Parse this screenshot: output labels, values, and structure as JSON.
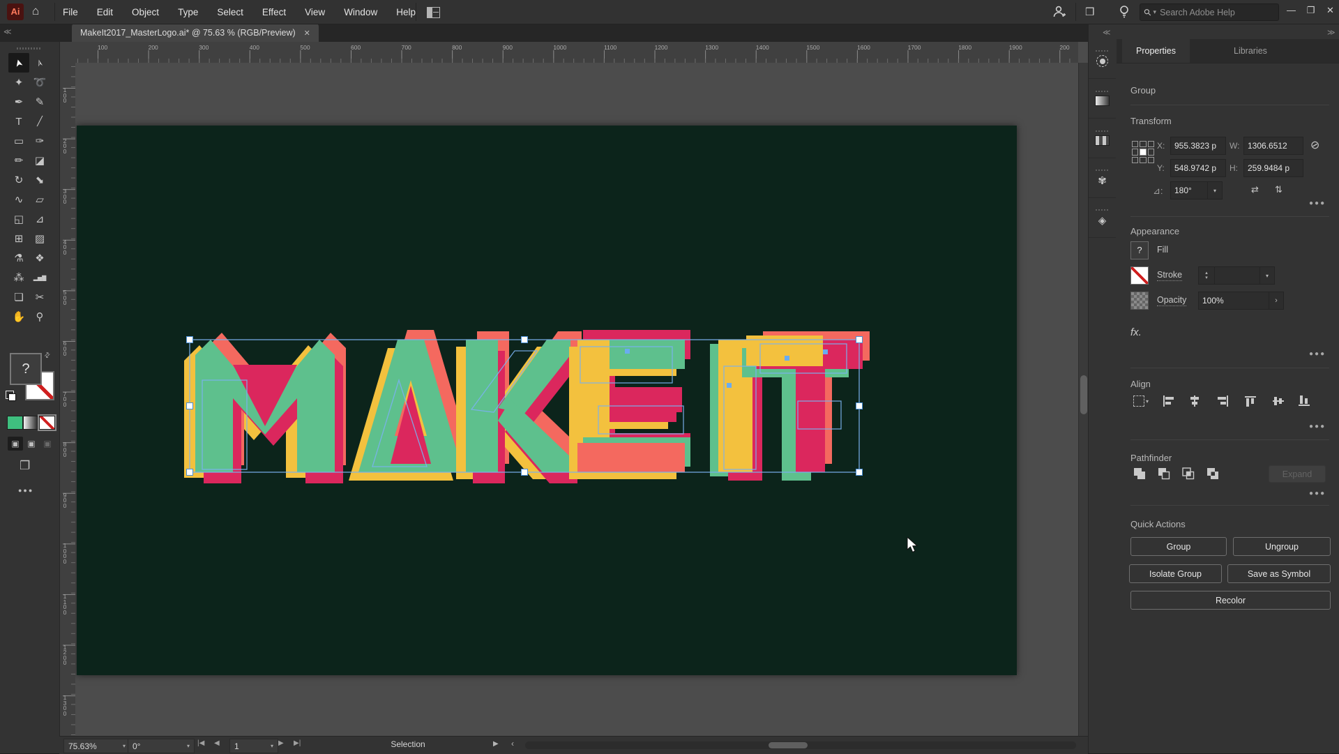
{
  "colors": {
    "accent_blue": "#7ab1ee",
    "logo_green": "#5ec08d",
    "logo_crimson": "#db275d",
    "logo_coral": "#f4695f",
    "logo_yellow": "#f3c13e",
    "artboard_bg": "#0c241b"
  },
  "titlebar": {
    "app_badge": "Ai",
    "menus": [
      "File",
      "Edit",
      "Object",
      "Type",
      "Select",
      "Effect",
      "View",
      "Window",
      "Help"
    ],
    "search_placeholder": "Search Adobe Help",
    "minimize": "—",
    "restore": "❐",
    "close": "✕"
  },
  "tab": {
    "title": "MakeIt2017_MasterLogo.ai* @ 75.63 % (RGB/Preview)",
    "close": "✕"
  },
  "toolbar": {
    "tools": [
      {
        "name": "selection",
        "glyph": "➤",
        "active": true
      },
      {
        "name": "direct-selection",
        "glyph": "➢"
      },
      {
        "name": "magic-wand",
        "glyph": "✦"
      },
      {
        "name": "lasso",
        "glyph": "➰"
      },
      {
        "name": "pen",
        "glyph": "✒"
      },
      {
        "name": "curvature",
        "glyph": "✎"
      },
      {
        "name": "type",
        "glyph": "T"
      },
      {
        "name": "line-segment",
        "glyph": "╱"
      },
      {
        "name": "rectangle",
        "glyph": "▭"
      },
      {
        "name": "paintbrush",
        "glyph": "✑"
      },
      {
        "name": "pencil",
        "glyph": "✏"
      },
      {
        "name": "eraser",
        "glyph": "◪"
      },
      {
        "name": "rotate",
        "glyph": "↻"
      },
      {
        "name": "scale",
        "glyph": "⬊"
      },
      {
        "name": "width",
        "glyph": "∿"
      },
      {
        "name": "free-transform",
        "glyph": "▱"
      },
      {
        "name": "shape-builder",
        "glyph": "◱"
      },
      {
        "name": "perspective-grid",
        "glyph": "⊿"
      },
      {
        "name": "mesh",
        "glyph": "⊞"
      },
      {
        "name": "gradient",
        "glyph": "▨"
      },
      {
        "name": "eyedropper",
        "glyph": "⚗"
      },
      {
        "name": "blend",
        "glyph": "❖"
      },
      {
        "name": "symbol-sprayer",
        "glyph": "⁂"
      },
      {
        "name": "column-graph",
        "glyph": "▂▅▇"
      },
      {
        "name": "artboard",
        "glyph": "❏"
      },
      {
        "name": "slice",
        "glyph": "✂"
      },
      {
        "name": "hand",
        "glyph": "✋"
      },
      {
        "name": "zoom",
        "glyph": "⚲"
      }
    ],
    "fill_unknown": "?"
  },
  "rulers": {
    "horizontal": [
      "100",
      "200",
      "300",
      "400",
      "500",
      "600",
      "700",
      "800",
      "900",
      "1000",
      "1100",
      "1200",
      "1300",
      "1400",
      "1500",
      "1600",
      "1700",
      "1800",
      "1900",
      "200"
    ],
    "vertical": [
      "100",
      "200",
      "300",
      "400",
      "500",
      "600",
      "700",
      "800",
      "900",
      "1000",
      "1100",
      "1200",
      "1300"
    ]
  },
  "artwork": {
    "text": "MAKE IT"
  },
  "panel": {
    "tabs": {
      "properties": "Properties",
      "libraries": "Libraries"
    },
    "selection_type": "Group",
    "transform": {
      "title": "Transform",
      "x_label": "X:",
      "x_value": "955.3823 p",
      "y_label": "Y:",
      "y_value": "548.9742 p",
      "w_label": "W:",
      "w_value": "1306.6512",
      "h_label": "H:",
      "h_value": "259.9484 p",
      "angle_value": "180°"
    },
    "appearance": {
      "title": "Appearance",
      "fill_label": "Fill",
      "fill_swatch": "?",
      "stroke_label": "Stroke",
      "stroke_value": "",
      "opacity_label": "Opacity",
      "opacity_value": "100%",
      "fx_label": "fx."
    },
    "align": {
      "title": "Align"
    },
    "pathfinder": {
      "title": "Pathfinder",
      "expand_label": "Expand"
    },
    "quick_actions": {
      "title": "Quick Actions",
      "buttons": [
        "Group",
        "Ungroup",
        "Isolate Group",
        "Save as Symbol",
        "Recolor"
      ]
    }
  },
  "statusbar": {
    "zoom": "75.63%",
    "rotation": "0°",
    "artboard_number": "1",
    "status": "Selection"
  }
}
